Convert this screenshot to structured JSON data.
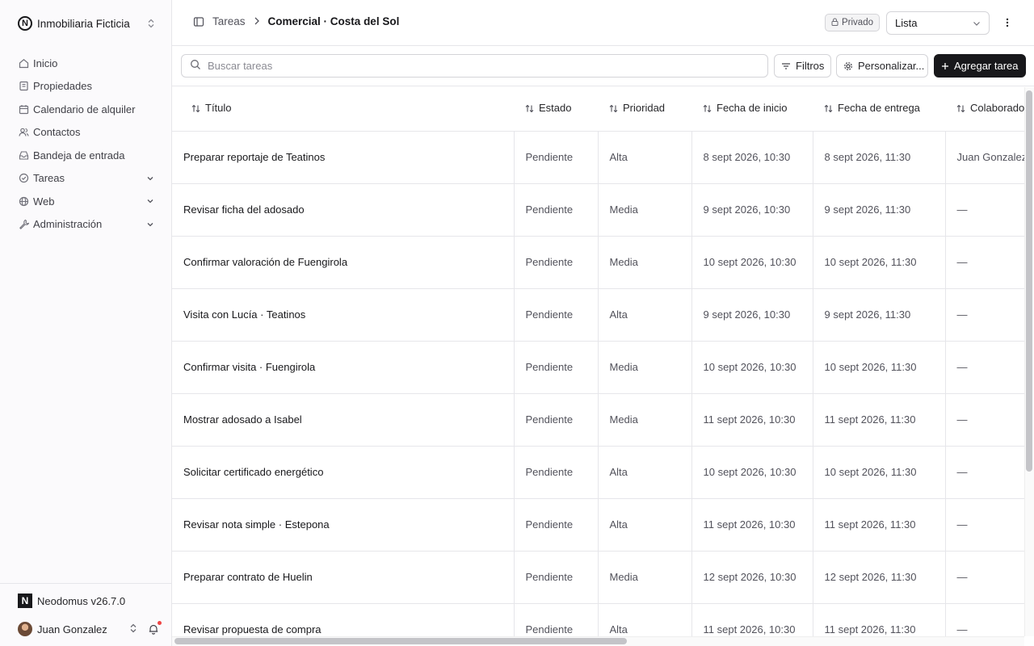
{
  "org": {
    "name": "Inmobiliaria Ficticia",
    "logo_letter": "N"
  },
  "sidebar": {
    "items": [
      {
        "label": "Inicio",
        "icon": "home-icon",
        "expandable": false
      },
      {
        "label": "Propiedades",
        "icon": "building-icon",
        "expandable": false
      },
      {
        "label": "Calendario de alquiler",
        "icon": "calendar-icon",
        "expandable": false
      },
      {
        "label": "Contactos",
        "icon": "users-icon",
        "expandable": false
      },
      {
        "label": "Bandeja de entrada",
        "icon": "inbox-icon",
        "expandable": false
      },
      {
        "label": "Tareas",
        "icon": "check-circle-icon",
        "expandable": true
      },
      {
        "label": "Web",
        "icon": "globe-icon",
        "expandable": true
      },
      {
        "label": "Administración",
        "icon": "wrench-icon",
        "expandable": true
      }
    ],
    "footer": {
      "version": "Neodomus v26.7.0",
      "version_logo": "N",
      "user_name": "Juan Gonzalez"
    }
  },
  "header": {
    "breadcrumb_parent": "Tareas",
    "breadcrumb_current": "Comercial · Costa del Sol",
    "privacy_badge": "Privado",
    "view_select": "Lista"
  },
  "toolbar": {
    "search_placeholder": "Buscar tareas",
    "filters_label": "Filtros",
    "customize_label": "Personalizar...",
    "add_label": "Agregar tarea"
  },
  "table": {
    "columns": [
      "Título",
      "Estado",
      "Prioridad",
      "Fecha de inicio",
      "Fecha de entrega",
      "Colaboradores"
    ],
    "rows": [
      {
        "title": "Preparar reportaje de Teatinos",
        "status": "Pendiente",
        "priority": "Alta",
        "start": "8 sept 2026, 10:30",
        "due": "8 sept 2026, 11:30",
        "collab": "Juan Gonzalez"
      },
      {
        "title": "Revisar ficha del adosado",
        "status": "Pendiente",
        "priority": "Media",
        "start": "9 sept 2026, 10:30",
        "due": "9 sept 2026, 11:30",
        "collab": "—"
      },
      {
        "title": "Confirmar valoración de Fuengirola",
        "status": "Pendiente",
        "priority": "Media",
        "start": "10 sept 2026, 10:30",
        "due": "10 sept 2026, 11:30",
        "collab": "—"
      },
      {
        "title": "Visita con Lucía · Teatinos",
        "status": "Pendiente",
        "priority": "Alta",
        "start": "9 sept 2026, 10:30",
        "due": "9 sept 2026, 11:30",
        "collab": "—"
      },
      {
        "title": "Confirmar visita · Fuengirola",
        "status": "Pendiente",
        "priority": "Media",
        "start": "10 sept 2026, 10:30",
        "due": "10 sept 2026, 11:30",
        "collab": "—"
      },
      {
        "title": "Mostrar adosado a Isabel",
        "status": "Pendiente",
        "priority": "Media",
        "start": "11 sept 2026, 10:30",
        "due": "11 sept 2026, 11:30",
        "collab": "—"
      },
      {
        "title": "Solicitar certificado energético",
        "status": "Pendiente",
        "priority": "Alta",
        "start": "10 sept 2026, 10:30",
        "due": "10 sept 2026, 11:30",
        "collab": "—"
      },
      {
        "title": "Revisar nota simple · Estepona",
        "status": "Pendiente",
        "priority": "Alta",
        "start": "11 sept 2026, 10:30",
        "due": "11 sept 2026, 11:30",
        "collab": "—"
      },
      {
        "title": "Preparar contrato de Huelin",
        "status": "Pendiente",
        "priority": "Media",
        "start": "12 sept 2026, 10:30",
        "due": "12 sept 2026, 11:30",
        "collab": "—"
      },
      {
        "title": "Revisar propuesta de compra",
        "status": "Pendiente",
        "priority": "Alta",
        "start": "11 sept 2026, 10:30",
        "due": "11 sept 2026, 11:30",
        "collab": "—"
      }
    ]
  }
}
